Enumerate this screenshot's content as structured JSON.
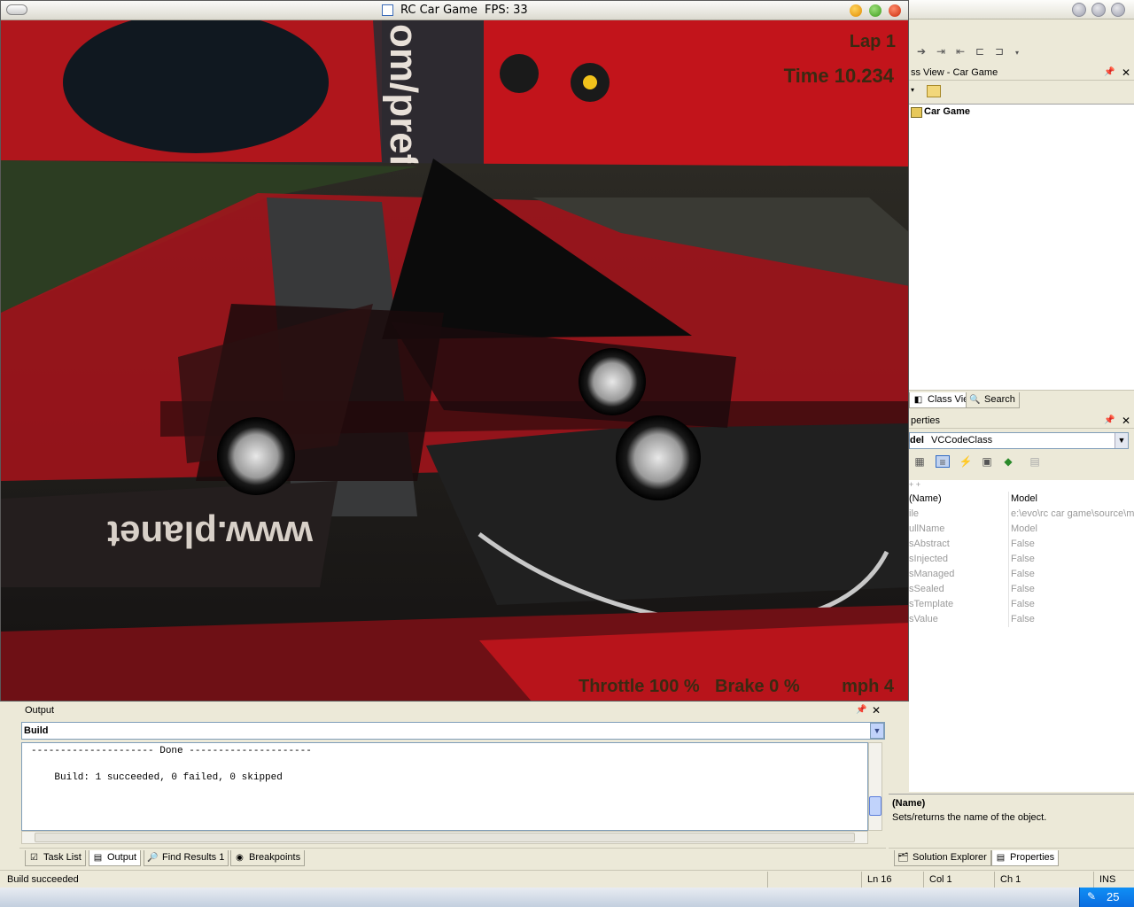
{
  "game_window": {
    "title": "RC Car Game",
    "fps_text": "FPS: 33",
    "hud": {
      "lap": "Lap 1",
      "time": "Time 10.234",
      "throttle": "Throttle 100 %",
      "brake": "Brake 0 %",
      "mph": "mph 4"
    },
    "billboard_text": "www.planet",
    "wall_text": "om/prefa"
  },
  "class_view": {
    "title": "ss View - Car Game",
    "tree_item": "Car Game",
    "tabs": [
      "Class View",
      "Search"
    ]
  },
  "properties": {
    "title": "perties",
    "object_label": "del",
    "object_value": "VCCodeClass",
    "expand_marker": "+ +",
    "header": {
      "key": "(Name)",
      "value": "Model"
    },
    "rows": [
      {
        "key": "ile",
        "value": "e:\\evo\\rc car game\\source\\m"
      },
      {
        "key": "ullName",
        "value": "Model"
      },
      {
        "key": "sAbstract",
        "value": "False"
      },
      {
        "key": "sInjected",
        "value": "False"
      },
      {
        "key": "sManaged",
        "value": "False"
      },
      {
        "key": "sSealed",
        "value": "False"
      },
      {
        "key": "sTemplate",
        "value": "False"
      },
      {
        "key": "sValue",
        "value": "False"
      }
    ],
    "desc_title": "(Name)",
    "desc_text": "Sets/returns the name of the object.",
    "tabs": [
      "Solution Explorer",
      "Properties"
    ]
  },
  "output": {
    "title": "Output",
    "selector": "Build",
    "line1": "--------------------- Done ---------------------",
    "line2": "    Build: 1 succeeded, 0 failed, 0 skipped",
    "tabs": [
      "Task List",
      "Output",
      "Find Results 1",
      "Breakpoints"
    ]
  },
  "status_bar": {
    "message": "Build succeeded",
    "ln": "Ln 16",
    "col": "Col 1",
    "ch": "Ch 1",
    "ins": "INS"
  },
  "taskbar": {
    "clock": "25"
  },
  "colors": {
    "game_red": "#c8141c",
    "ide_face": "#ece9d8",
    "hud_text": "#3a2a12"
  }
}
